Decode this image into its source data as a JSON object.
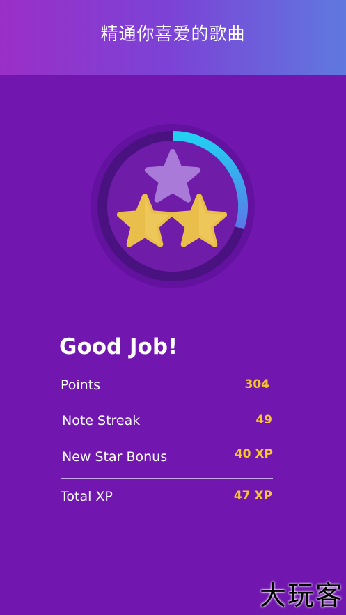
{
  "header": {
    "title": "精通你喜爱的歌曲"
  },
  "badge": {
    "stars_total": 3,
    "stars_earned": 2,
    "progress": 0.3
  },
  "results": {
    "heading": "Good Job!",
    "rows": [
      {
        "label": "Points",
        "value": "304"
      },
      {
        "label": "Note Streak",
        "value": "49"
      },
      {
        "label": "New Star Bonus",
        "value": "40 XP"
      }
    ],
    "total": {
      "label": "Total XP",
      "value": "47 XP"
    }
  },
  "watermark": "大玩客",
  "colors": {
    "background": "#7216b0",
    "accent": "#f7c531",
    "progress": "#27c3f0"
  }
}
